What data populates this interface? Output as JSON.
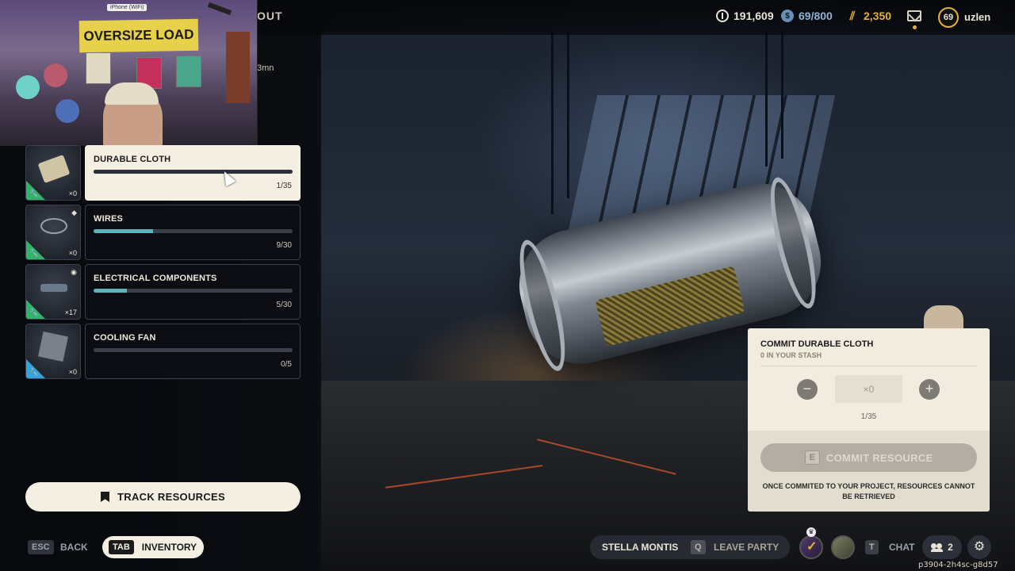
{
  "header": {
    "title_fragment": "OUT",
    "sub_fragment": "3mn",
    "currencies": [
      {
        "icon": "coin-icon",
        "value": "191,609"
      },
      {
        "icon": "credits-icon",
        "value": "69/800"
      },
      {
        "icon": "gold-icon",
        "value": "2,350"
      }
    ],
    "currency_colors": {
      "coin": "#e8e4d8",
      "credits": "#6a8fb3",
      "gold": "#e5b233"
    },
    "level": "69",
    "username": "uzlen"
  },
  "webcam": {
    "banner": "OVERSIZE LOAD",
    "device_label": "iPhone (WiFi)"
  },
  "resources": [
    {
      "name": "DURABLE CLOTH",
      "count": "×0",
      "progress": "1/35",
      "fraction": 0.03,
      "icon": "cloth-icon",
      "active": true
    },
    {
      "name": "WIRES",
      "count": "×0",
      "progress": "9/30",
      "fraction": 0.3,
      "icon": "wires-icon",
      "badge": "diamond-icon"
    },
    {
      "name": "ELECTRICAL COMPONENTS",
      "count": "×17",
      "progress": "5/30",
      "fraction": 0.167,
      "icon": "electrical-components-icon",
      "badge": "eye-icon"
    },
    {
      "name": "COOLING FAN",
      "count": "×0",
      "progress": "0/5",
      "fraction": 0,
      "icon": "cooling-fan-icon"
    }
  ],
  "track_button": {
    "label": "TRACK RESOURCES"
  },
  "controls": {
    "back_key": "ESC",
    "back_label": "BACK",
    "inventory_key": "TAB",
    "inventory_label": "INVENTORY"
  },
  "commit_panel": {
    "title": "COMMIT DURABLE CLOTH",
    "subtitle": "0 IN YOUR STASH",
    "minus": "−",
    "plus": "+",
    "quantity": "×0",
    "progress": "1/35",
    "commit_key": "E",
    "commit_label": "COMMIT RESOURCE",
    "warning": "ONCE COMMITED TO YOUR PROJECT, RESOURCES CANNOT BE RETRIEVED"
  },
  "party": {
    "name": "STELLA MONTIS",
    "leave_key": "Q",
    "leave_label": "LEAVE PARTY",
    "chat_key": "T",
    "chat_label": "CHAT",
    "friends_count": "2"
  },
  "session_id": "p3904-2h4sc-g8d57"
}
